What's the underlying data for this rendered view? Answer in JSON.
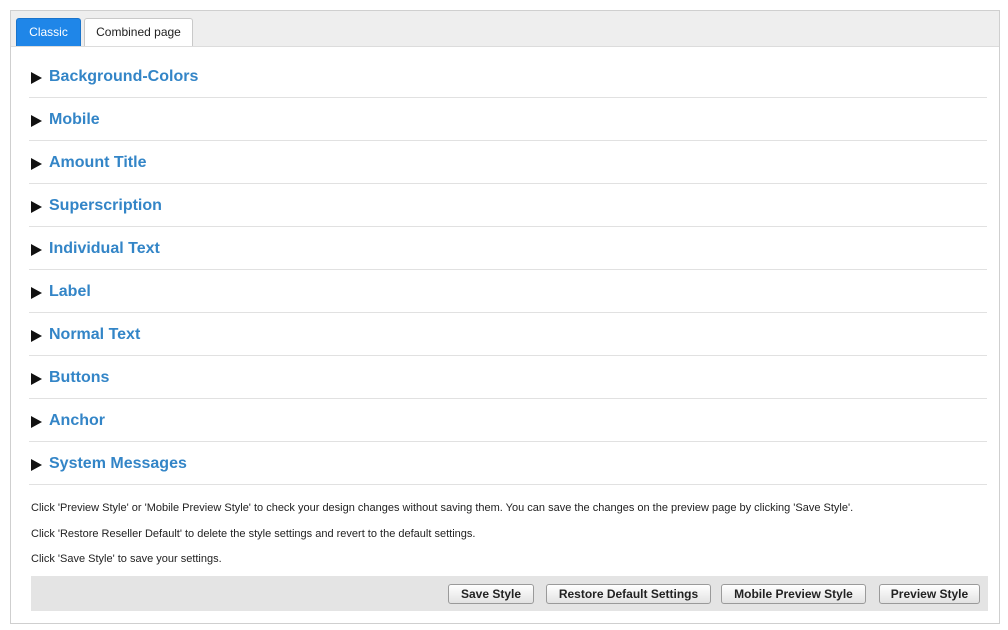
{
  "tabs": [
    {
      "label": "Classic",
      "active": true
    },
    {
      "label": "Combined page",
      "active": false
    }
  ],
  "sections": [
    {
      "label": "Background-Colors"
    },
    {
      "label": "Mobile"
    },
    {
      "label": "Amount Title"
    },
    {
      "label": "Superscription"
    },
    {
      "label": "Individual Text"
    },
    {
      "label": "Label"
    },
    {
      "label": "Normal Text"
    },
    {
      "label": "Buttons"
    },
    {
      "label": "Anchor"
    },
    {
      "label": "System Messages"
    }
  ],
  "info": {
    "preview_hint": "Click 'Preview Style' or 'Mobile Preview Style' to check your design changes without saving them. You can save the changes on the preview page by clicking 'Save Style'.",
    "restore_hint": "Click 'Restore Reseller Default' to delete the style settings and revert to the default settings.",
    "save_hint": "Click 'Save Style' to save your settings."
  },
  "buttons": {
    "save": "Save Style",
    "restore": "Restore Default Settings",
    "mobile_preview": "Mobile Preview Style",
    "preview": "Preview Style"
  },
  "colors": {
    "active_tab": "#1f86e8",
    "section_label": "#3385c7"
  }
}
